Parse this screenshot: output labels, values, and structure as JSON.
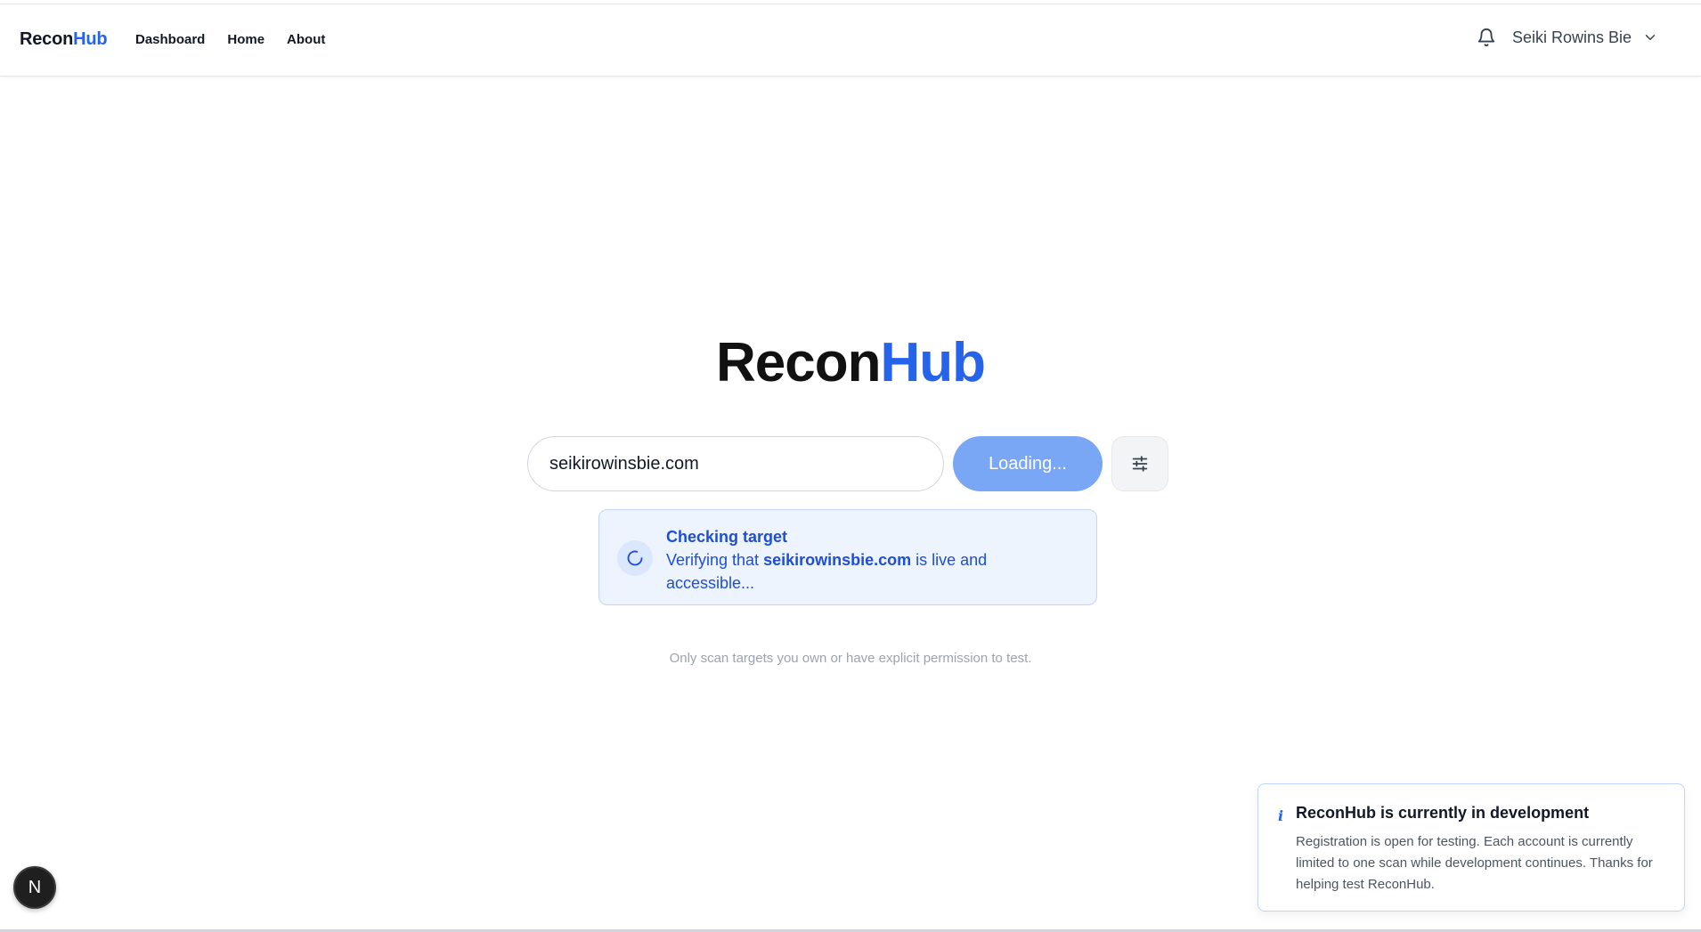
{
  "navbar": {
    "brand_main": "Recon",
    "brand_accent": "Hub",
    "links": [
      "Dashboard",
      "Home",
      "About"
    ],
    "user_name": "Seiki Rowins Bie"
  },
  "hero": {
    "title_main": "Recon",
    "title_accent": "Hub"
  },
  "search": {
    "value": "seikirowinsbie.com",
    "button_label": "Loading..."
  },
  "status": {
    "title": "Checking target",
    "prefix": "Verifying that ",
    "target": "seikirowinsbie.com",
    "suffix": " is live and accessible..."
  },
  "disclaimer": "Only scan targets you own or have explicit permission to test.",
  "toast": {
    "icon": "i",
    "title": "ReconHub is currently in development",
    "body": "Registration is open for testing. Each account is currently limited to one scan while development continues. Thanks for helping test ReconHub."
  },
  "floating_badge": "N",
  "colors": {
    "accent": "#2563eb",
    "button_loading": "#7aa6f6",
    "status_bg": "#eef4fe"
  },
  "icons": {
    "notifications": "bell-icon",
    "user_menu": "chevron-down-icon",
    "settings": "sliders-icon",
    "status": "spinner-icon",
    "toast": "info-icon"
  }
}
